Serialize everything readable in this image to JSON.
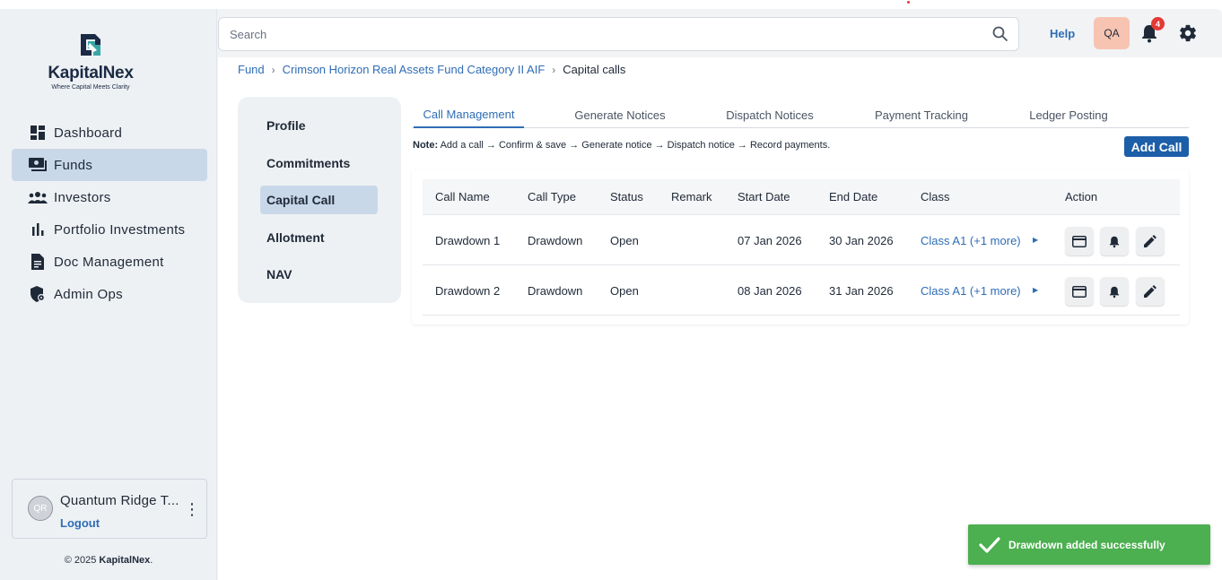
{
  "brand": {
    "name": "KapitalNex",
    "tagline": "Where Capital Meets Clarity",
    "colors": {
      "primary": "#1d5ea8",
      "link": "#2f6db5",
      "active_bg": "#c9d8e9",
      "success": "#4caf50",
      "danger": "#e53935"
    }
  },
  "sidebar": {
    "items": [
      {
        "label": "Dashboard",
        "icon": "dashboard-icon",
        "active": false
      },
      {
        "label": "Funds",
        "icon": "funds-icon",
        "active": true
      },
      {
        "label": "Investors",
        "icon": "investors-icon",
        "active": false
      },
      {
        "label": "Portfolio Investments",
        "icon": "bar-chart-icon",
        "active": false
      },
      {
        "label": "Doc Management",
        "icon": "document-icon",
        "active": false
      },
      {
        "label": "Admin Ops",
        "icon": "admin-shield-icon",
        "active": false
      }
    ],
    "user": {
      "initials": "QR",
      "name": "Quantum Ridge T...",
      "logout_label": "Logout"
    },
    "copyright_prefix": "© 2025",
    "copyright_brand": "KapitalNex",
    "copyright_suffix": "."
  },
  "header": {
    "search_placeholder": "Search",
    "help_label": "Help",
    "user_initials": "QA",
    "notification_count": "4"
  },
  "breadcrumb": {
    "items": [
      "Fund",
      "Crimson Horizon Real Assets Fund Category II AIF",
      "Capital calls"
    ],
    "separator": "›"
  },
  "subnav": {
    "items": [
      {
        "label": "Profile",
        "active": false
      },
      {
        "label": "Commitments",
        "active": false
      },
      {
        "label": "Capital Call",
        "active": true
      },
      {
        "label": "Allotment",
        "active": false
      },
      {
        "label": "NAV",
        "active": false
      }
    ]
  },
  "tabs": [
    {
      "label": "Call Management",
      "active": true
    },
    {
      "label": "Generate Notices",
      "active": false
    },
    {
      "label": "Dispatch Notices",
      "active": false
    },
    {
      "label": "Payment Tracking",
      "active": false
    },
    {
      "label": "Ledger Posting",
      "active": false
    }
  ],
  "note": {
    "label": "Note:",
    "text": "Add a call → Confirm & save → Generate notice → Dispatch notice → Record payments."
  },
  "add_call_label": "Add Call",
  "table": {
    "columns": [
      "Call Name",
      "Call Type",
      "Status",
      "Remark",
      "Start Date",
      "End Date",
      "Class",
      "Action"
    ],
    "rows": [
      {
        "call_name": "Drawdown 1",
        "call_type": "Drawdown",
        "status": "Open",
        "remark": "",
        "start_date": "07 Jan 2026",
        "end_date": "30 Jan 2026",
        "class": "Class A1 (+1 more)"
      },
      {
        "call_name": "Drawdown 2",
        "call_type": "Drawdown",
        "status": "Open",
        "remark": "",
        "start_date": "08 Jan 2026",
        "end_date": "31 Jan 2026",
        "class": "Class A1 (+1 more)"
      }
    ],
    "action_icons": [
      "payment-card-icon",
      "bell-icon",
      "edit-pencil-icon"
    ]
  },
  "toast": {
    "message": "Drawdown added successfully",
    "icon": "check-icon"
  }
}
